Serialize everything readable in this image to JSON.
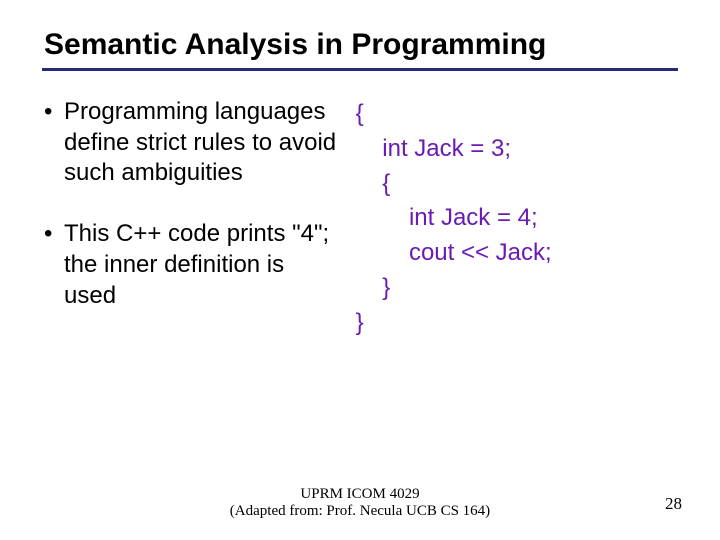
{
  "title": "Semantic Analysis in Programming",
  "bullets": [
    "Programming languages define strict rules to avoid such ambiguities",
    "This C++ code prints \"4\"; the inner definition is used"
  ],
  "code": {
    "l1": "{",
    "l2": "    int Jack = 3;",
    "l3": "    {",
    "l4": "        int Jack = 4;",
    "l5": "        cout << Jack;",
    "l6": "    }",
    "l7": "}"
  },
  "footer": {
    "line1": "UPRM ICOM 4029",
    "line2": "(Adapted from: Prof. Necula  UCB CS 164)"
  },
  "page_number": "28"
}
